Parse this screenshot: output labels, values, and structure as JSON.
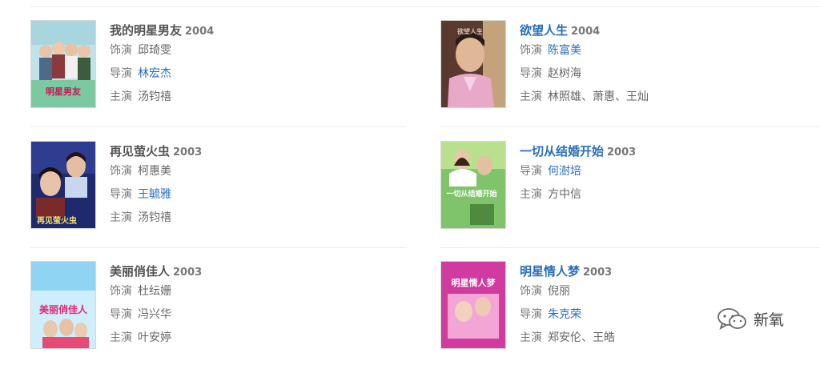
{
  "labels": {
    "role": "饰演",
    "director": "导演",
    "cast": "主演"
  },
  "items": [
    {
      "title": "我的明星男友",
      "year": "2004",
      "role": "邱琦雯",
      "director": "林宏杰",
      "cast": "汤钧禧",
      "poster_text": "明星男友"
    },
    {
      "title": "欲望人生",
      "year": "2004",
      "role": "陈富美",
      "director": "赵树海",
      "cast": "林照雄、萧惠、王灿",
      "poster_text": "欲望人生"
    },
    {
      "title": "再见萤火虫",
      "year": "2003",
      "role": "柯惠美",
      "director": "王毓雅",
      "cast": "汤钧禧",
      "poster_text": "再见萤火虫"
    },
    {
      "title": "一切从结婚开始",
      "year": "2003",
      "director": "何澍培",
      "cast": "方中信",
      "poster_text": "一切从结婚开始"
    },
    {
      "title": "美丽俏佳人",
      "year": "2003",
      "role": "杜纭姗",
      "director": "冯兴华",
      "cast": "叶安婷",
      "poster_text": "美丽俏佳人"
    },
    {
      "title": "明星情人梦",
      "year": "2003",
      "role": "倪丽",
      "director": "朱克荣",
      "cast": "郑安伦、王皓",
      "poster_text": "明星情人梦"
    }
  ],
  "watermark": {
    "text": "新氧",
    "icon": "wechat-icon"
  },
  "colors": {
    "link": "#2a6ebb",
    "text": "#666666",
    "divider": "#ececec"
  }
}
